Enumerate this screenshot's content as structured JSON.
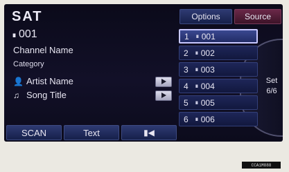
{
  "header": {
    "title": "SAT"
  },
  "channel": {
    "number": "001",
    "name": "Channel Name",
    "category": "Category"
  },
  "track": {
    "artist": "Artist Name",
    "song": "Song Title"
  },
  "top_buttons": {
    "options": "Options",
    "source": "Source"
  },
  "bottom_buttons": {
    "scan": "SCAN",
    "text": "Text"
  },
  "presets": [
    {
      "index": "1",
      "channel": "001",
      "selected": true
    },
    {
      "index": "2",
      "channel": "002"
    },
    {
      "index": "3",
      "channel": "003"
    },
    {
      "index": "4",
      "channel": "004"
    },
    {
      "index": "5",
      "channel": "005"
    },
    {
      "index": "6",
      "channel": "006"
    }
  ],
  "set_indicator": {
    "label": "Set",
    "page": "6/6"
  },
  "corner_tag": "CCA1M888",
  "icons": {
    "channel": "ch-icon",
    "artist": "person-icon",
    "song": "note-icon",
    "play": "play-icon",
    "mute": "speaker-mute-icon"
  },
  "colors": {
    "background": "#0b0a1a",
    "button_blue": "#2e3a72",
    "source_button": "#6a2848",
    "selected_border": "#c8c8ff"
  }
}
